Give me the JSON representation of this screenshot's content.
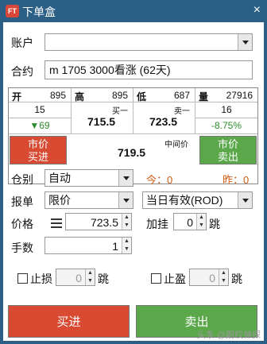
{
  "window": {
    "title": "下单盒",
    "logo_text": "FT",
    "close": "×"
  },
  "account": {
    "label": "账户",
    "value": ""
  },
  "contract": {
    "label": "合约",
    "value": "m 1705 3000看涨 (62天)"
  },
  "quote": {
    "open_label": "开",
    "open": "895",
    "high_label": "高",
    "high": "895",
    "low_label": "低",
    "low": "687",
    "vol_label": "量",
    "vol": "27916",
    "bid_qty": "15",
    "ask_qty": "16",
    "change": "▼69",
    "change_pct": "-8.75%",
    "bid1_label": "买一",
    "bid1": "715.5",
    "ask1_label": "卖一",
    "ask1": "723.5",
    "mid_label": "中间价",
    "mid": "719.5",
    "market_buy": "市价买进",
    "market_sell": "市价卖出"
  },
  "position": {
    "label": "仓别",
    "value": "自动",
    "today": "今：0",
    "yesterday": "昨：0"
  },
  "order": {
    "label": "报单",
    "type": "限价",
    "validity": "当日有效(ROD)"
  },
  "price": {
    "label": "价格",
    "value": "723.5",
    "tick_label": "跳",
    "add_label": "加挂",
    "add_value": "0"
  },
  "lots": {
    "label": "手数",
    "value": "1"
  },
  "stop_loss": {
    "label": "止损",
    "value": "0",
    "unit": "跳"
  },
  "take_profit": {
    "label": "止盈",
    "value": "0",
    "unit": "跳"
  },
  "buttons": {
    "buy": "买进",
    "sell": "卖出"
  },
  "watermark": "头条 @期权神探",
  "colors": {
    "title_bar": "#2c5f85",
    "buy": "#d84a32",
    "sell": "#5aa84a",
    "up": "#2e8b2e",
    "orange": "#d05a10"
  }
}
